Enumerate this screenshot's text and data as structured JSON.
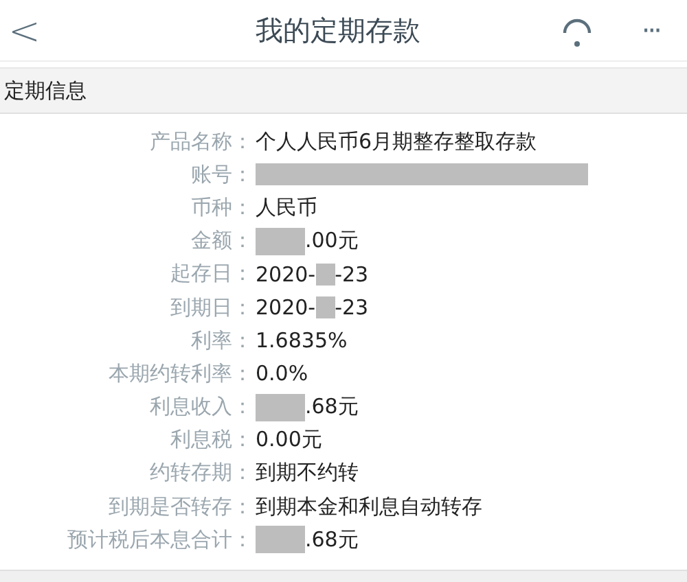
{
  "header": {
    "back": "<",
    "title": "我的定期存款",
    "more": "···"
  },
  "section": {
    "title": "定期信息"
  },
  "rows": [
    {
      "label": "产品名称：",
      "kind": "text",
      "value": "个人人民币6月期整存整取存款"
    },
    {
      "label": "账号：",
      "kind": "masked_full"
    },
    {
      "label": "币种：",
      "kind": "text",
      "value": "人民币"
    },
    {
      "label": "金额：",
      "kind": "masked",
      "value": ".00元"
    },
    {
      "label": "起存日：",
      "kind": "masked_mid",
      "value": "2020-",
      "value_end": "-23"
    },
    {
      "label": "到期日：",
      "kind": "masked_mid",
      "value": "2020-",
      "value_end": "-23"
    },
    {
      "label": "利率：",
      "kind": "text",
      "value": "1.6835%"
    },
    {
      "label": "本期约转利率：",
      "kind": "text",
      "value": "0.0%"
    },
    {
      "label": "利息收入：",
      "kind": "masked",
      "value": ".68元"
    },
    {
      "label": "利息税：",
      "kind": "text",
      "value": "0.00元"
    },
    {
      "label": "约转存期：",
      "kind": "text",
      "value": "到期不约转"
    },
    {
      "label": "到期是否转存：",
      "kind": "text",
      "value": "到期本金和利息自动转存"
    },
    {
      "label": "预计税后本息合计：",
      "kind": "masked",
      "value": ".68元"
    }
  ]
}
